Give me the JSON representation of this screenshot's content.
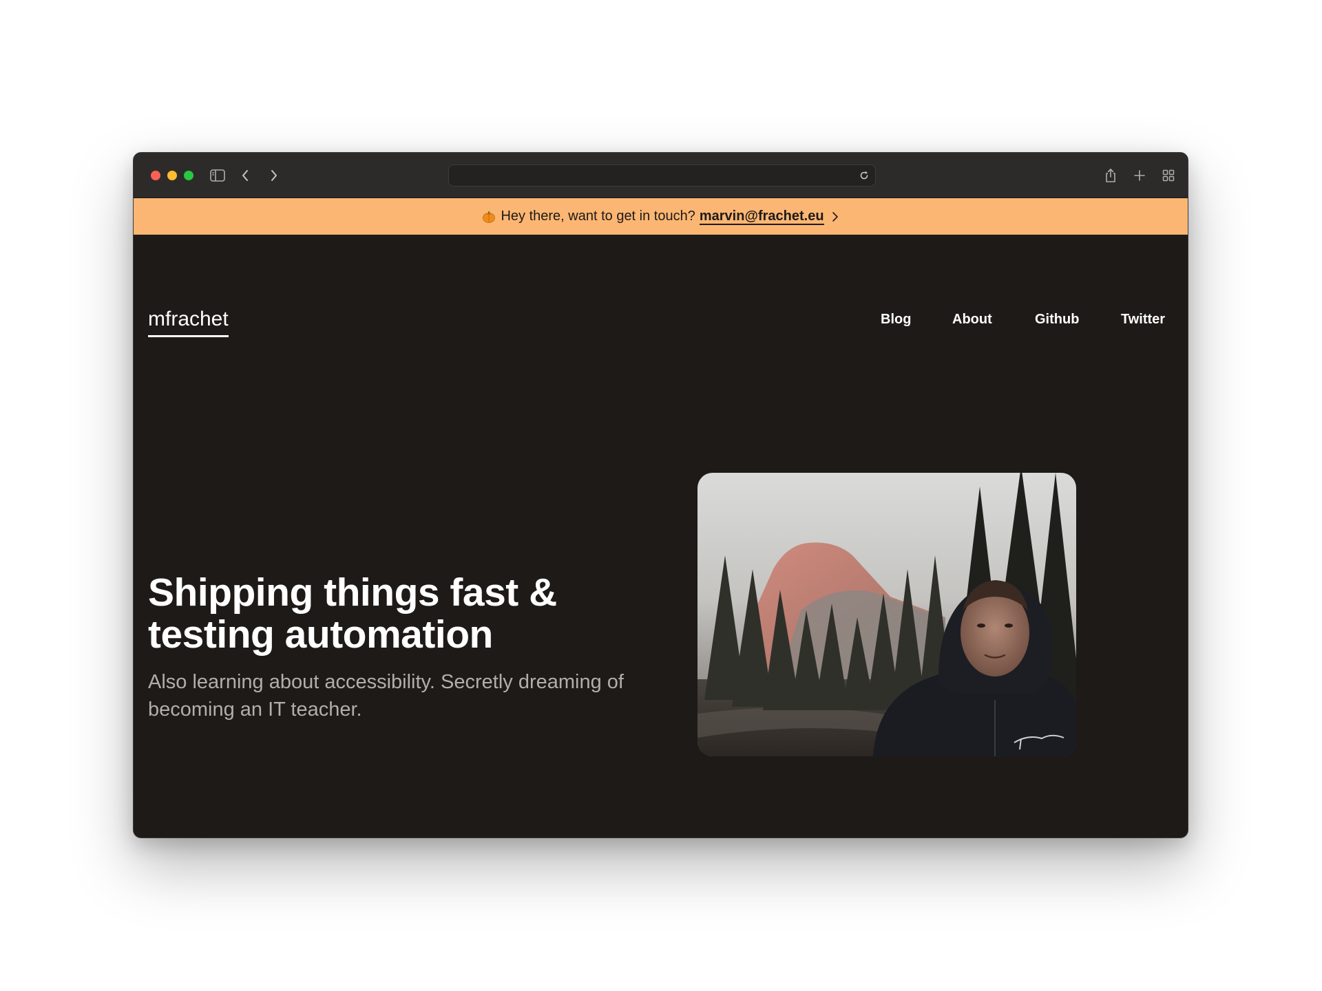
{
  "browser": {
    "address_value": "",
    "icons": {
      "sidebar": "sidebar-icon",
      "back": "chevron-left-icon",
      "forward": "chevron-right-icon",
      "reload": "reload-icon",
      "share": "share-icon",
      "new_tab": "plus-icon",
      "tab_overview": "tab-overview-icon"
    }
  },
  "banner": {
    "text": "Hey there, want to get in touch?",
    "email": "marvin@frachet.eu",
    "emoji_icon": "pumpkin-icon",
    "background": "#fcb673"
  },
  "header": {
    "logo": "mfrachet",
    "nav": [
      {
        "label": "Blog"
      },
      {
        "label": "About"
      },
      {
        "label": "Github"
      },
      {
        "label": "Twitter"
      }
    ]
  },
  "hero": {
    "title": "Shipping things fast & testing automation",
    "subtitle": "Also learning about accessibility. Secretly dreaming of becoming an IT teacher.",
    "photo_alt": "Portrait in front of a mountain and forest"
  },
  "colors": {
    "page_background": "#1e1a17",
    "text": "#ffffff",
    "muted_text": "#b3aea9",
    "accent": "#fcb673"
  }
}
